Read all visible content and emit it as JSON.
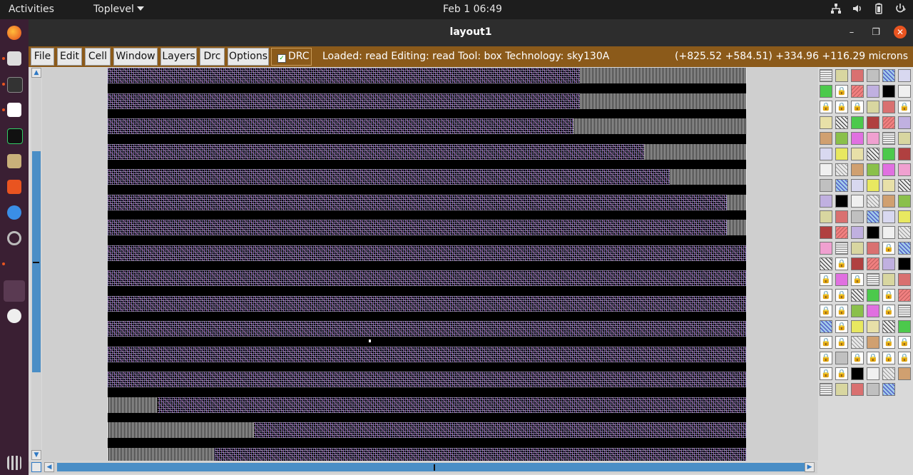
{
  "topbar": {
    "activities": "Activities",
    "app_menu": "Toplevel",
    "clock": "Feb 1  06:49",
    "tray_icons": [
      "network-icon",
      "volume-icon",
      "battery-icon",
      "power-icon"
    ]
  },
  "dock": {
    "icons": [
      "firefox-icon",
      "files-icon",
      "terminal-icon",
      "text-editor-icon",
      "system-monitor-icon",
      "file-manager-icon",
      "software-center-icon",
      "help-icon",
      "settings-icon",
      "app-icon",
      "disc-icon",
      "show-applications-icon"
    ]
  },
  "window": {
    "title": "layout1",
    "minimize_label": "–",
    "maximize_label": "❐",
    "close_label": "✕"
  },
  "menubar": {
    "items": [
      {
        "label": "File"
      },
      {
        "label": "Edit"
      },
      {
        "label": "Cell"
      },
      {
        "label": "Window"
      },
      {
        "label": "Layers"
      },
      {
        "label": "Drc"
      },
      {
        "label": "Options"
      }
    ],
    "drc_label": "DRC",
    "drc_checked": true,
    "status": "Loaded: read Editing: read Tool: box  Technology: sky130A",
    "coords": "(+825.52 +584.51) +334.96 +116.29 microns"
  },
  "colors": {
    "menubar_bg": "#8b5a1a",
    "scroll_accent": "#4a8ec6",
    "canvas_bg": "#cfcfcf",
    "layout_bg": "#000000",
    "close_btn": "#e95420"
  }
}
